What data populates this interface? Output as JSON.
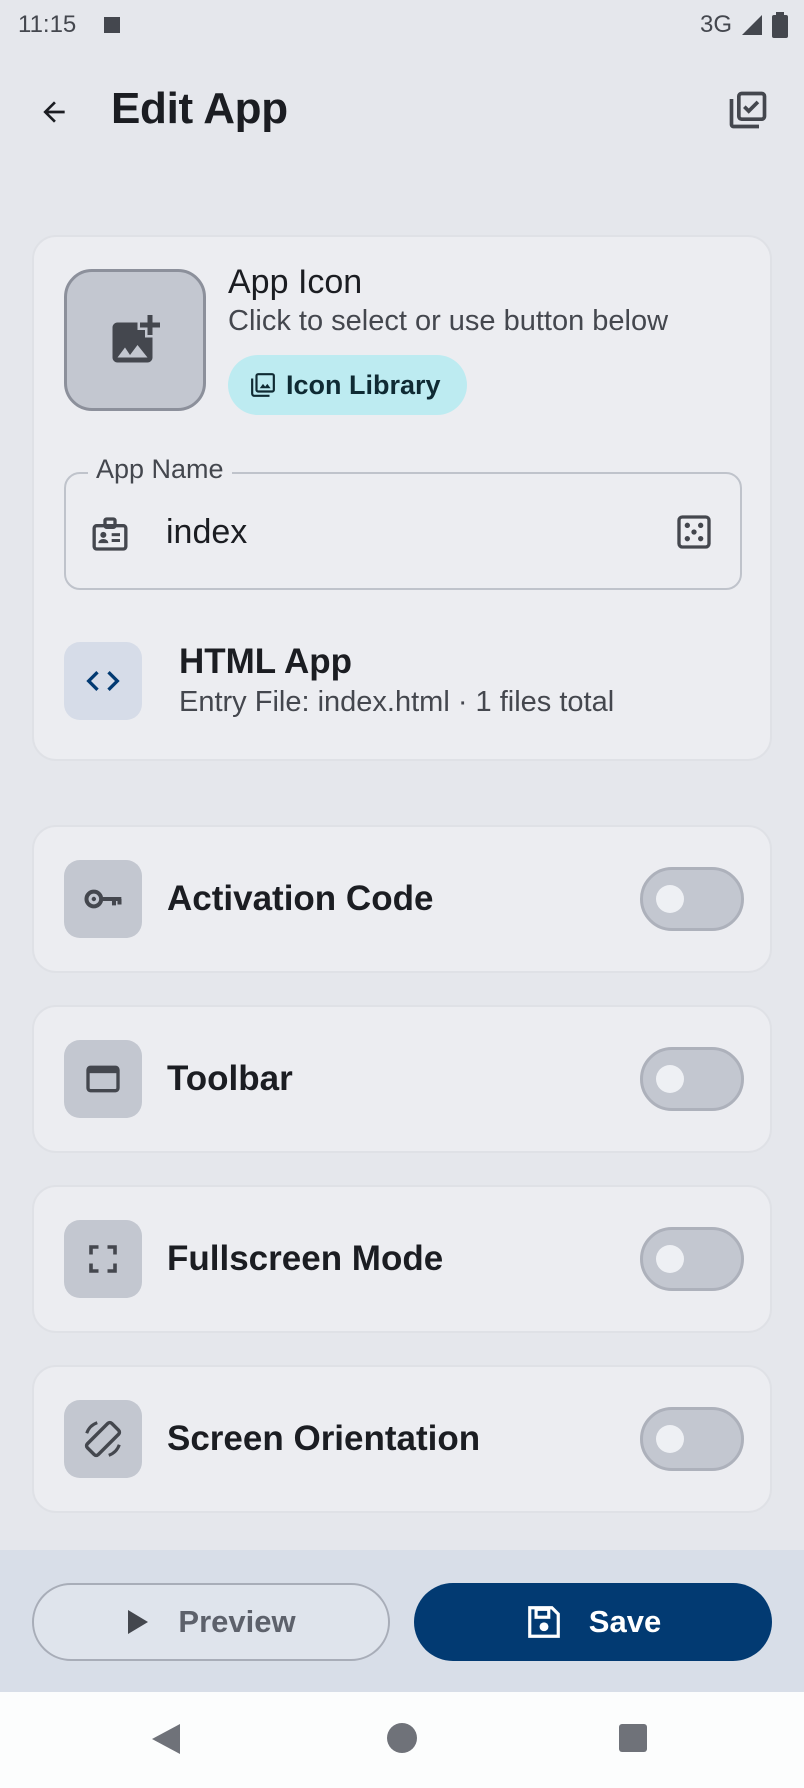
{
  "status_bar": {
    "time": "11:15",
    "network": "3G"
  },
  "app_bar": {
    "title": "Edit App"
  },
  "app_icon_section": {
    "title": "App Icon",
    "subtitle": "Click to select or use button below",
    "icon_library_label": "Icon Library"
  },
  "app_name_field": {
    "label": "App Name",
    "value": "index"
  },
  "app_type": {
    "title": "HTML App",
    "subtitle": "Entry File: index.html · 1 files total"
  },
  "settings": [
    {
      "label": "Activation Code",
      "icon": "key-icon",
      "enabled": false
    },
    {
      "label": "Toolbar",
      "icon": "window-icon",
      "enabled": false
    },
    {
      "label": "Fullscreen Mode",
      "icon": "fullscreen-icon",
      "enabled": false
    },
    {
      "label": "Screen Orientation",
      "icon": "screen-rotation-icon",
      "enabled": false
    }
  ],
  "actions": {
    "preview_label": "Preview",
    "save_label": "Save"
  },
  "colors": {
    "primary": "#023a72",
    "chip": "#bdebf1",
    "background": "#e5e7ec"
  }
}
